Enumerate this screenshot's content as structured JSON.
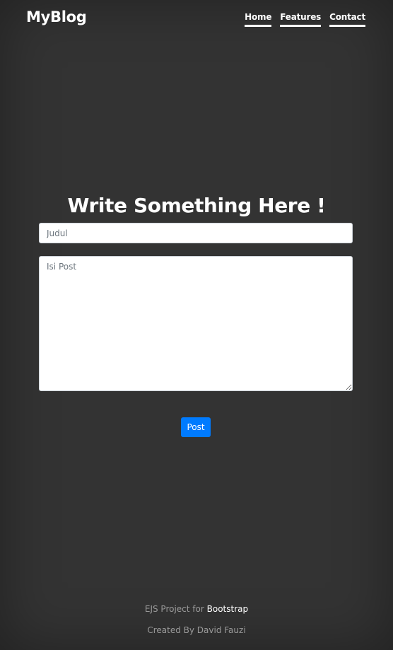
{
  "navbar": {
    "brand": "MyBlog",
    "links": [
      {
        "label": "Home"
      },
      {
        "label": "Features"
      },
      {
        "label": "Contact"
      }
    ]
  },
  "main": {
    "heading": "Write Something Here !",
    "title_input": {
      "placeholder": "Judul",
      "value": ""
    },
    "body_textarea": {
      "placeholder": "Isi Post",
      "value": ""
    },
    "post_button_label": "Post"
  },
  "footer": {
    "line1_prefix": "EJS Project for ",
    "line1_link": "Bootstrap",
    "line2": "Created By David Fauzi"
  },
  "colors": {
    "background": "#333333",
    "primary": "#007bff",
    "text": "#ffffff",
    "muted": "#9a9a9a"
  }
}
